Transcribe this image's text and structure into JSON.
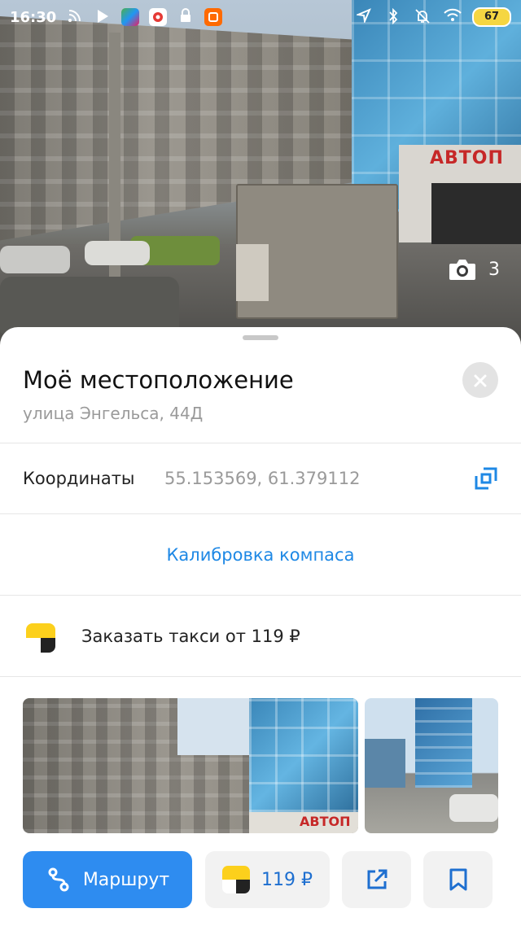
{
  "status_bar": {
    "time": "16:30",
    "battery": "67",
    "left_icons": [
      "rss-icon",
      "play-store-icon",
      "maps-app-icon",
      "vpn-app-icon",
      "lock-icon",
      "mi-app-icon"
    ],
    "right_icons": [
      "location-icon",
      "bluetooth-icon",
      "mute-icon",
      "wifi-icon"
    ]
  },
  "hero": {
    "sign_text": "АВТОП",
    "photo_count": "3"
  },
  "place": {
    "title": "Моё местоположение",
    "address": "улица Энгельса, 44Д"
  },
  "coordinates": {
    "label": "Координаты",
    "value": "55.153569, 61.379112"
  },
  "calibrate_label": "Калибровка компаса",
  "taxi": {
    "label": "Заказать такси от 119 ₽"
  },
  "gallery": {
    "sign_text": "АВТОП"
  },
  "actions": {
    "route_label": "Маршрут",
    "taxi_price": "119 ₽"
  },
  "colors": {
    "accent": "#2e8cf0",
    "link": "#1e88e5",
    "taxi_yellow": "#fcd01c",
    "taxi_black": "#222222"
  }
}
